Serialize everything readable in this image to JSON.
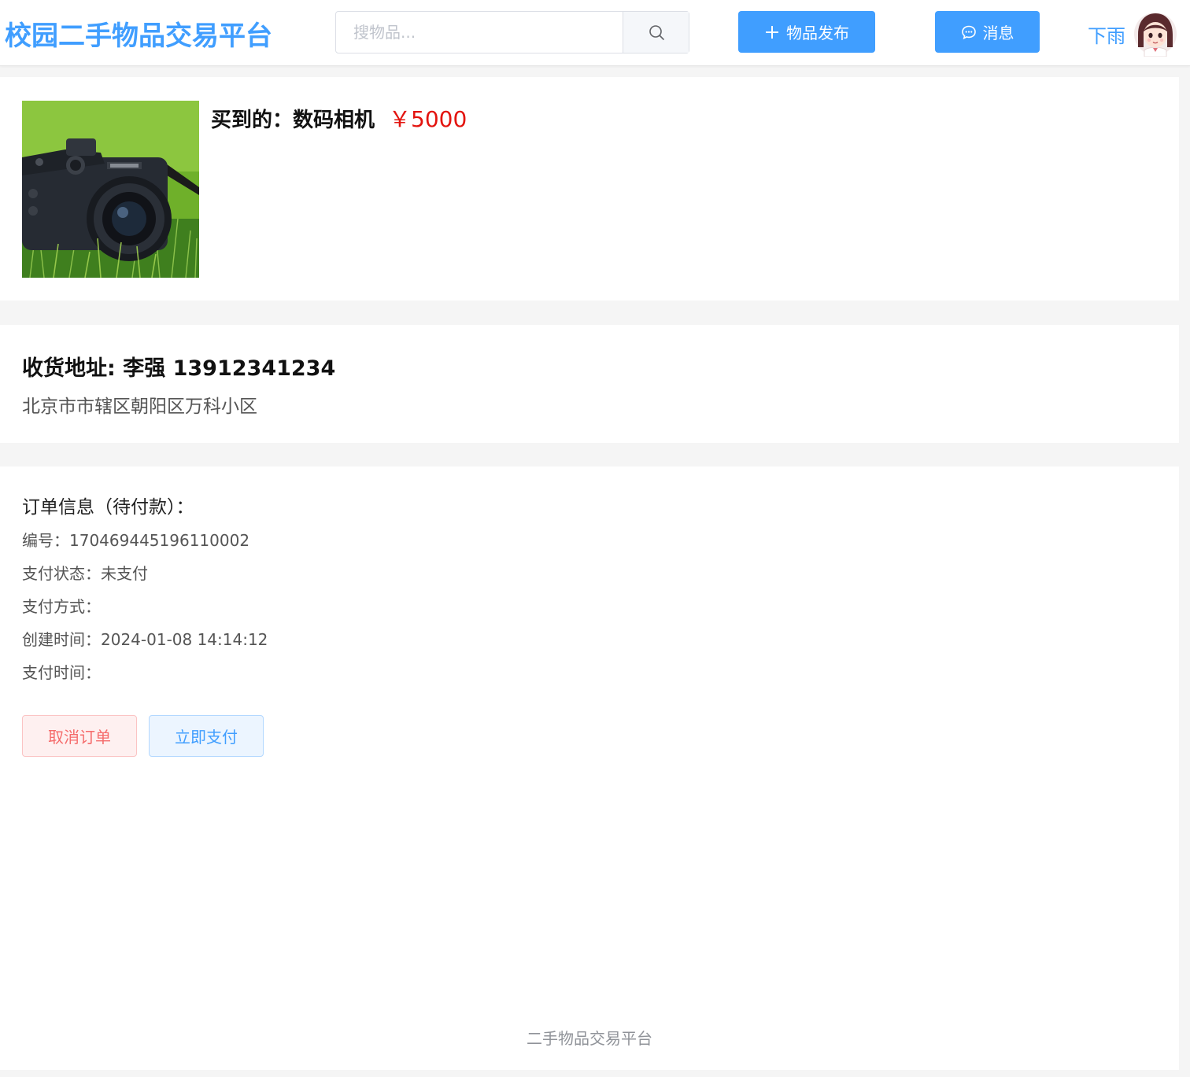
{
  "header": {
    "site_title": "校园二手物品交易平台",
    "search_placeholder": "搜物品...",
    "publish_label": "物品发布",
    "message_label": "消息",
    "username": "下雨"
  },
  "product": {
    "bought_label": "买到的：数码相机",
    "price": "￥5000"
  },
  "address": {
    "title": "收货地址: 李强 13912341234",
    "detail": "北京市市辖区朝阳区万科小区"
  },
  "order": {
    "heading": "订单信息（待付款）：",
    "number": "编号：170469445196110002",
    "pay_status": "支付状态：未支付",
    "pay_method": "支付方式：",
    "created_at": "创建时间：2024-01-08 14:14:12",
    "pay_time": "支付时间：",
    "cancel_label": "取消订单",
    "pay_label": "立即支付"
  },
  "footer": {
    "text": "二手物品交易平台"
  },
  "colors": {
    "primary": "#409eff",
    "price_red": "#e3140f",
    "danger": "#f56c6c",
    "background": "#f5f5f5"
  },
  "icons": {
    "search": "search-icon",
    "publish": "plus-icon",
    "message": "chat-icon"
  }
}
